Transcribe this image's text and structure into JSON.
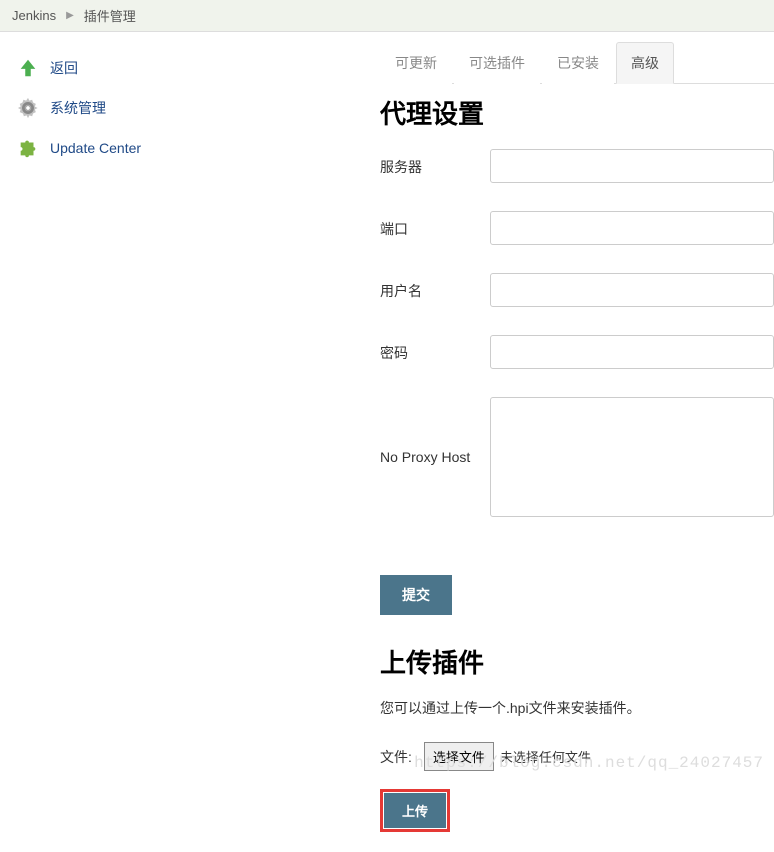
{
  "breadcrumb": {
    "root": "Jenkins",
    "current": "插件管理"
  },
  "sidebar": {
    "items": [
      {
        "label": "返回",
        "icon": "arrow-up"
      },
      {
        "label": "系统管理",
        "icon": "gear"
      },
      {
        "label": "Update Center",
        "icon": "puzzle"
      }
    ]
  },
  "tabs": [
    {
      "label": "可更新",
      "active": false
    },
    {
      "label": "可选插件",
      "active": false
    },
    {
      "label": "已安装",
      "active": false
    },
    {
      "label": "高级",
      "active": true
    }
  ],
  "proxy_section": {
    "title": "代理设置",
    "fields": {
      "server_label": "服务器",
      "server_value": "",
      "port_label": "端口",
      "port_value": "",
      "username_label": "用户名",
      "username_value": "",
      "password_label": "密码",
      "password_value": "",
      "noproxy_label": "No Proxy Host",
      "noproxy_value": ""
    },
    "submit_label": "提交"
  },
  "upload_section": {
    "title": "上传插件",
    "description": "您可以通过上传一个.hpi文件来安装插件。",
    "file_label": "文件:",
    "choose_file_label": "选择文件",
    "no_file_text": "未选择任何文件",
    "upload_button_label": "上传"
  },
  "watermark": "https://blog.csdn.net/qq_24027457"
}
